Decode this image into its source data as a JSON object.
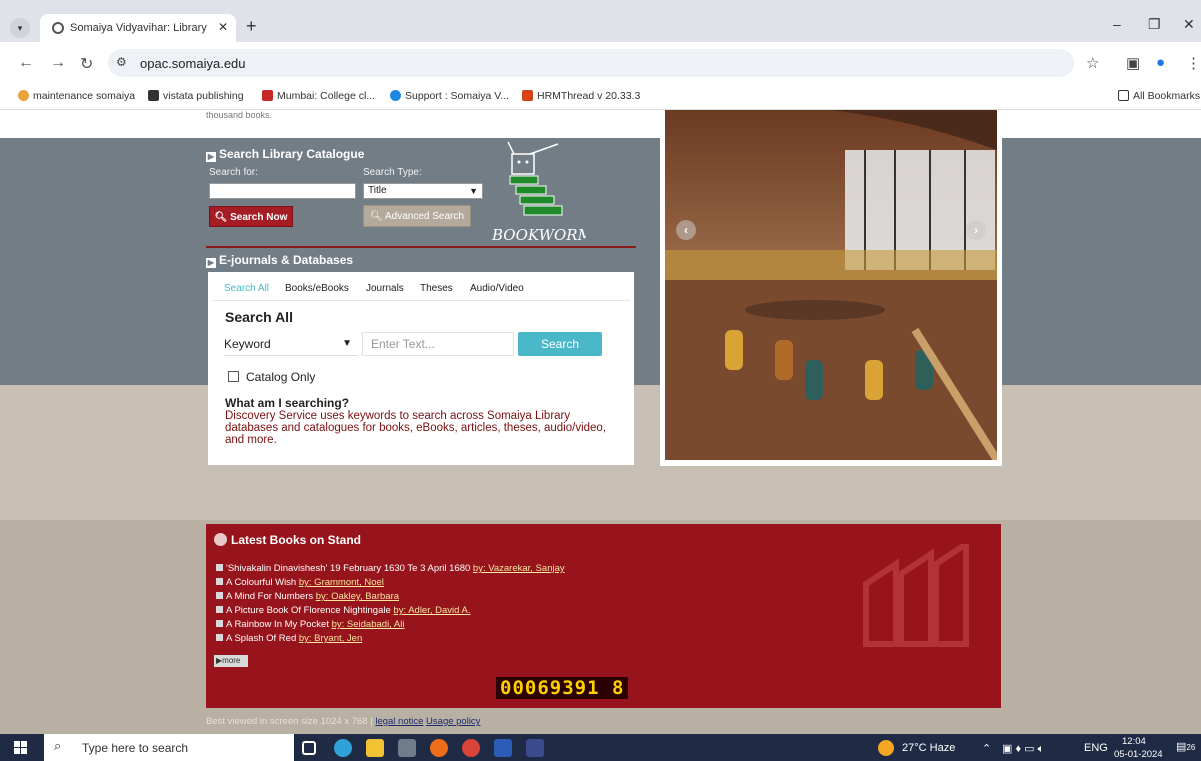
{
  "browser": {
    "tab_title": "Somaiya Vidyavihar: Library Onl",
    "url": "opac.somaiya.edu",
    "bookmarks": [
      {
        "label": "maintenance somaiya",
        "color": "#e8a33d"
      },
      {
        "label": "vistata publishing",
        "color": "#333333"
      },
      {
        "label": "Mumbai: College cl...",
        "color": "#c62828"
      },
      {
        "label": "Support : Somaiya V...",
        "color": "#1e88e5"
      },
      {
        "label": "HRMThread v 20.33.3",
        "color": "#d84315"
      }
    ],
    "all_bookmarks": "All Bookmarks"
  },
  "page": {
    "top_snippet": "thousand books.",
    "catalogue": {
      "heading": "Search Library Catalogue",
      "search_for_label": "Search for:",
      "search_type_label": "Search Type:",
      "search_type_value": "Title",
      "search_now": "Search Now",
      "advanced_search": "Advanced Search",
      "logo_text": "BOOKWORM"
    },
    "ejournals": {
      "heading": "E-journals & Databases",
      "tabs": [
        "Search All",
        "Books/eBooks",
        "Journals",
        "Theses",
        "Audio/Video"
      ],
      "title": "Search All",
      "field_select": "Keyword",
      "input_placeholder": "Enter Text...",
      "search_button": "Search",
      "catalog_only": "Catalog Only",
      "what_title": "What am I searching?",
      "what_desc": "Discovery Service uses keywords to search across Somaiya Library databases and catalogues for books, eBooks, articles, theses, audio/video, and more."
    },
    "latest": {
      "heading": "Latest Books on Stand",
      "books": [
        {
          "title": "'Shivakalin Dinavishesh' 19 February 1630 Te 3 April 1680",
          "author": "by: Vazarekar, Sanjay"
        },
        {
          "title": "A Colourful Wish",
          "author": "by: Grammont, Noel"
        },
        {
          "title": "A Mind For Numbers",
          "author": "by: Oakley, Barbara"
        },
        {
          "title": "A Picture Book Of Florence Nightingale",
          "author": "by: Adler, David A."
        },
        {
          "title": "A Rainbow In My Pocket",
          "author": "by: Seidabadi, Ali"
        },
        {
          "title": "A Splash Of Red",
          "author": "by: Bryant, Jen"
        }
      ],
      "more": "more",
      "counter": "00069391 8"
    },
    "footer": {
      "text": "Best viewed in screen size 1024 x 768 |",
      "legal": "legal notice",
      "usage": "Usage policy"
    }
  },
  "taskbar": {
    "search_placeholder": "Type here to search",
    "weather": "27°C Haze",
    "lang": "ENG",
    "time": "12:04",
    "date": "05-01-2024",
    "notifications": "26"
  }
}
